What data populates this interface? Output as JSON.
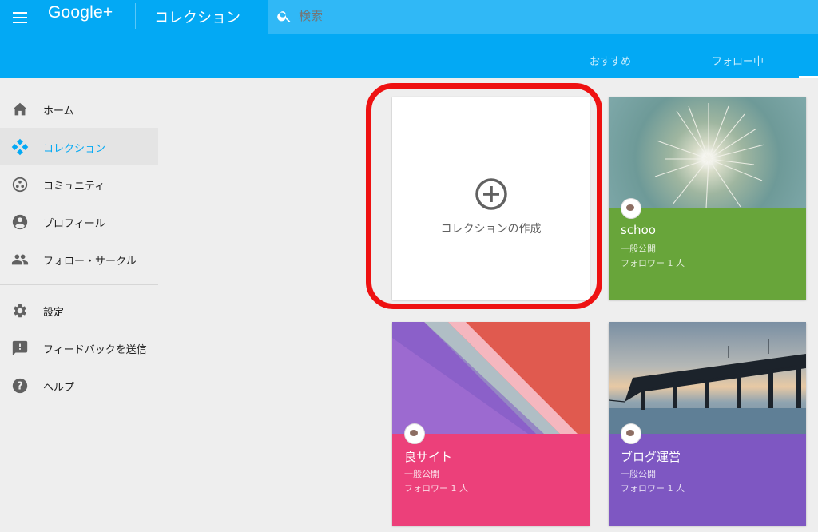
{
  "header": {
    "logo": "Google+",
    "page_title": "コレクション",
    "search_placeholder": "検索",
    "tabs": [
      {
        "label": "おすすめ"
      },
      {
        "label": "フォロー中"
      }
    ]
  },
  "sidebar": {
    "items": [
      {
        "label": "ホーム",
        "icon": "home-icon"
      },
      {
        "label": "コレクション",
        "icon": "collections-icon",
        "active": true
      },
      {
        "label": "コミュニティ",
        "icon": "communities-icon"
      },
      {
        "label": "プロフィール",
        "icon": "profile-icon"
      },
      {
        "label": "フォロー・サークル",
        "icon": "people-icon"
      }
    ],
    "secondary": [
      {
        "label": "設定",
        "icon": "gear-icon"
      },
      {
        "label": "フィードバックを送信",
        "icon": "feedback-icon"
      },
      {
        "label": "ヘルプ",
        "icon": "help-icon"
      }
    ]
  },
  "create_card": {
    "label": "コレクションの作成"
  },
  "collections": [
    {
      "name": "schoo",
      "visibility": "一般公開",
      "followers": "フォロワー 1 人",
      "color": "#68a53a"
    },
    {
      "name": "良サイト",
      "visibility": "一般公開",
      "followers": "フォロワー 1 人",
      "color": "#ec407a"
    },
    {
      "name": "ブログ運営",
      "visibility": "一般公開",
      "followers": "フォロワー 1 人",
      "color": "#7e57c2"
    }
  ],
  "colors": {
    "header": "#03a9f4",
    "highlight": "#ee1111"
  }
}
